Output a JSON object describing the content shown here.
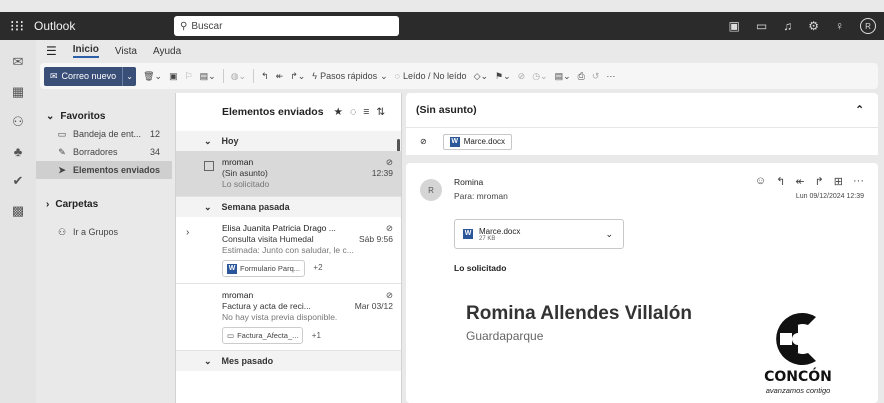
{
  "titlebar": {
    "app_name": "Outlook",
    "search_placeholder": "Buscar"
  },
  "tabs": [
    "Inicio",
    "Vista",
    "Ayuda"
  ],
  "ribbon": {
    "new_mail": "Correo nuevo",
    "quick_steps": "Pasos rápidos",
    "read_unread": "Leído / No leído",
    "more": "···"
  },
  "folders": {
    "favorites_label": "Favoritos",
    "items": [
      {
        "label": "Bandeja de ent...",
        "count": "12"
      },
      {
        "label": "Borradores",
        "count": "34"
      },
      {
        "label": "Elementos enviados",
        "count": ""
      }
    ],
    "folders_label": "Carpetas",
    "groups_label": "Ir a Grupos"
  },
  "message_list": {
    "title": "Elementos enviados",
    "groups": {
      "today": "Hoy",
      "last_week": "Semana pasada",
      "last_month": "Mes pasado"
    },
    "items": [
      {
        "sender": "mroman",
        "subject": "(Sin asunto)",
        "time": "12:39",
        "preview": "Lo solicitado"
      },
      {
        "sender": "Elisa Juanita Patricia Drago ...",
        "subject": "Consulta visita Humedal",
        "time": "Sáb 9:56",
        "preview": "Estimada: Junto con saludar, le c...",
        "attachment": "Formulario Parq...",
        "extra": "+2"
      },
      {
        "sender": "mroman",
        "subject": "Factura y acta de reci...",
        "time": "Mar 03/12",
        "preview": "No hay vista previa disponible.",
        "attachment": "Factura_Afecta_...",
        "extra": "+1"
      }
    ]
  },
  "reading": {
    "subject": "(Sin asunto)",
    "top_attachment": "Marce.docx",
    "sender_initial": "R",
    "sender": "Romina",
    "to_line": "Para: mroman",
    "date": "Lun 09/12/2024 12:39",
    "attachment_name": "Marce.docx",
    "attachment_size": "27 KB",
    "body": "Lo solicitado",
    "signature_name": "Romina Allendes Villalón",
    "signature_role": "Guardaparque",
    "logo_text": "CONCÓN",
    "logo_sub": "avanzamos contigo"
  },
  "colors": {
    "accent": "#3a4f78",
    "titlebar": "#2b2b2b",
    "word": "#2b579a"
  }
}
